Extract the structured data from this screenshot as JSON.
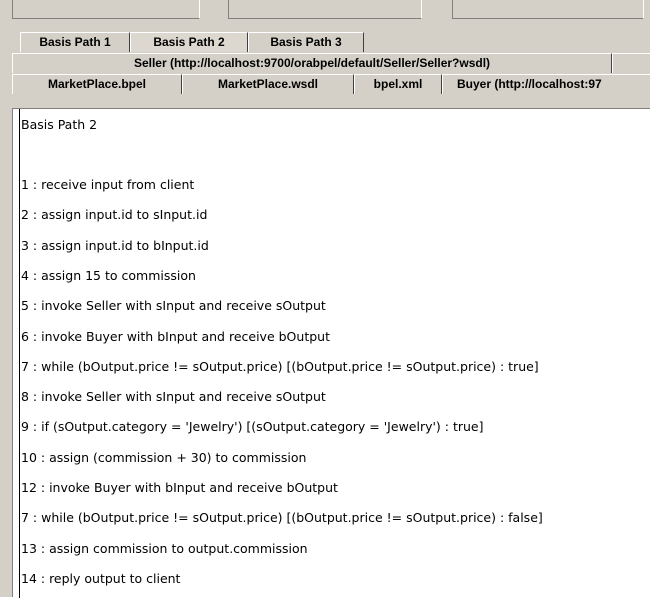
{
  "tabs": {
    "row1": [
      {
        "label": "Basis Path 1",
        "selected": false
      },
      {
        "label": "Basis Path 2",
        "selected": true
      },
      {
        "label": "Basis Path 3",
        "selected": false
      }
    ],
    "row2": [
      {
        "label": "Seller (http://localhost:9700/orabpel/default/Seller/Seller?wsdl)"
      },
      {
        "label": ""
      }
    ],
    "row3": [
      {
        "label": "MarketPlace.bpel"
      },
      {
        "label": "MarketPlace.wsdl"
      },
      {
        "label": "bpel.xml"
      },
      {
        "label": "Buyer (http://localhost:97"
      }
    ]
  },
  "content": {
    "title": "Basis Path 2",
    "lines": [
      "1 : receive input from client",
      "2 : assign input.id to sInput.id",
      "3 : assign input.id to bInput.id",
      "4 : assign 15 to commission",
      "5 : invoke Seller with sInput and receive sOutput",
      "6 : invoke Buyer with bInput and receive bOutput",
      "7 : while (bOutput.price != sOutput.price) [(bOutput.price != sOutput.price) : true]",
      "8 : invoke Seller with sInput and receive sOutput",
      "9 : if (sOutput.category = 'Jewelry') [(sOutput.category = 'Jewelry') : true]",
      "10 : assign (commission + 30) to commission",
      "12 : invoke Buyer with bInput and receive bOutput",
      "7 : while (bOutput.price != sOutput.price) [(bOutput.price != sOutput.price) : false]",
      "13 : assign commission to output.commission",
      "14 : reply output to client"
    ]
  }
}
